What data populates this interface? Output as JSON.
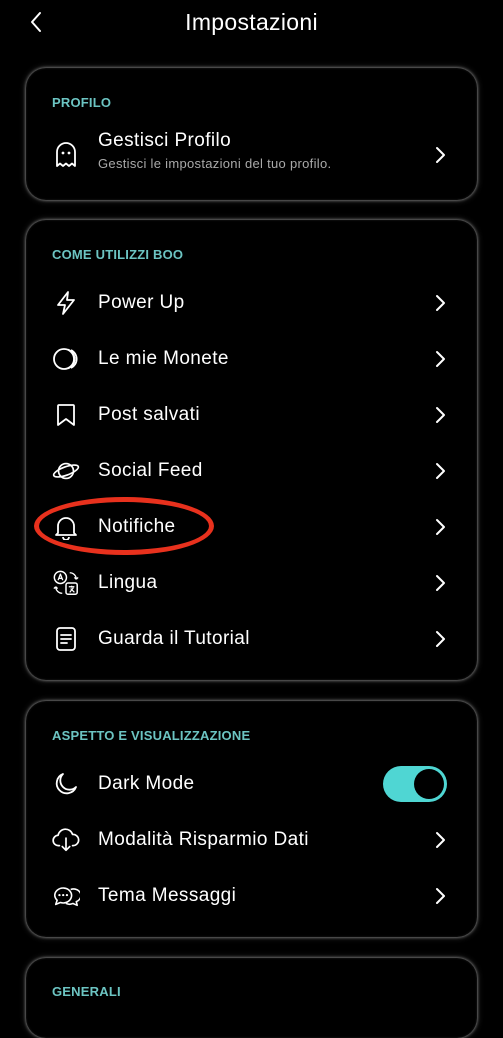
{
  "header": {
    "title": "Impostazioni",
    "back_icon": "chevron-left-icon"
  },
  "profile_section": {
    "heading": "PROFILO",
    "item": {
      "label": "Gestisci Profilo",
      "subtitle": "Gestisci le impostazioni del tuo profilo.",
      "icon": "ghost-icon"
    }
  },
  "usage_section": {
    "heading": "COME UTILIZZI BOO",
    "items": [
      {
        "label": "Power Up",
        "icon": "lightning-icon"
      },
      {
        "label": "Le mie Monete",
        "icon": "coins-icon"
      },
      {
        "label": "Post salvati",
        "icon": "bookmark-icon"
      },
      {
        "label": "Social Feed",
        "icon": "planet-icon"
      },
      {
        "label": "Notifiche",
        "icon": "bell-icon"
      },
      {
        "label": "Lingua",
        "icon": "translate-icon"
      },
      {
        "label": "Guarda il Tutorial",
        "icon": "document-icon"
      }
    ]
  },
  "appearance_section": {
    "heading": "ASPETTO E VISUALIZZAZIONE",
    "items": [
      {
        "label": "Dark Mode",
        "icon": "moon-icon",
        "toggle": true,
        "toggle_on": true
      },
      {
        "label": "Modalità Risparmio Dati",
        "icon": "cloud-download-icon"
      },
      {
        "label": "Tema Messaggi",
        "icon": "chat-bubbles-icon"
      }
    ]
  },
  "general_section": {
    "heading": "GENERALI"
  },
  "colors": {
    "accent": "#6cc4c2",
    "toggle_track": "#4fd6d3",
    "annotation": "#e8311d",
    "background": "#000000"
  }
}
